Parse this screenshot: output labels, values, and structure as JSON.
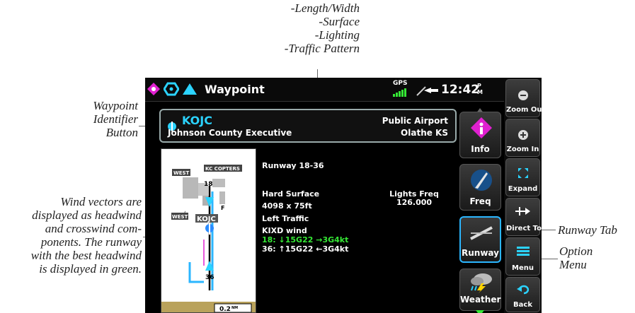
{
  "callouts": {
    "runway_info": [
      "-Length/Width",
      "-Surface",
      "-Lighting",
      "-Traffic Pattern"
    ],
    "waypoint_id": [
      "Waypoint",
      "Identifier",
      "Button"
    ],
    "wind": [
      "Wind vectors are",
      "displayed as headwind",
      "and crosswind com-",
      "ponents.  The runway",
      "with the best headwind",
      "is displayed in green."
    ],
    "runway_tab": "Runway Tab",
    "option_menu": [
      "Option",
      "Menu"
    ]
  },
  "titlebar": {
    "title": "Waypoint",
    "gps_label": "GPS",
    "time": "12:42",
    "ampm_top": "P",
    "ampm_bottom": "M"
  },
  "waypoint": {
    "identifier": "KOJC",
    "name": "Johnson County Executive",
    "type": "Public Airport",
    "city": "Olathe KS"
  },
  "map": {
    "labels": [
      "WEST 1",
      "KC COPTERS",
      "WEST 3",
      "KOJC",
      "18",
      "F",
      "36"
    ],
    "scale": "0.2",
    "scale_unit": "NM"
  },
  "runway": {
    "heading": "Runway 18-36",
    "surface": "Hard Surface",
    "dimensions": "4098 x 75ft",
    "traffic": "Left Traffic",
    "lights_label": "Lights Freq",
    "lights_freq": "126.000",
    "wind_source": "KIXD wind",
    "wind_18": "18: ↓15G22 →3G4kt",
    "wind_36": "36: ↑15G22 ←3G4kt"
  },
  "tabs": [
    "Info",
    "Freq",
    "Runway",
    "Weather"
  ],
  "buttons": [
    "Zoom Out",
    "Zoom In",
    "Expand",
    "Direct To",
    "Menu",
    "Back"
  ],
  "colors": {
    "accent_cyan": "#2bd3ff",
    "wind_green": "#35e835",
    "tab_magenta": "#e020d0",
    "active_blue": "#2bb6ff"
  }
}
